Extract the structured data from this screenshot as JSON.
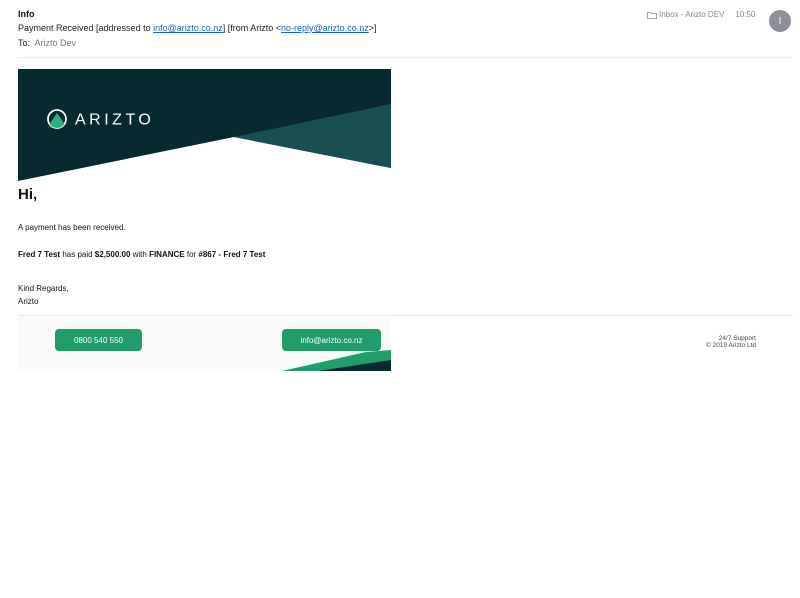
{
  "header": {
    "sender": "Info",
    "subject_prefix": "Payment Received [addressed to ",
    "addressed_email": "info@arizto.co.nz",
    "subject_middle": "] [from Arizto <",
    "from_email": "no-reply@arizto.co.nz",
    "subject_suffix": ">]",
    "to_label": "To:",
    "to_name": "Arizto Dev",
    "folder": "Inbox - Arizto DEV",
    "time": "10:50",
    "avatar_letter": "I"
  },
  "brand": {
    "logo_text": "ARIZTO"
  },
  "body": {
    "greeting": "Hi,",
    "line1": "A payment has been received.",
    "payer": "Fred 7 Test",
    "has_paid": " has paid ",
    "amount": "$2,500.00",
    "with": " with ",
    "method": "FINANCE",
    "for": " for ",
    "invoice": "#867 - Fred 7 Test",
    "signoff": "Kind Regards,",
    "signname": "Arizto"
  },
  "footer": {
    "phone": "0800 540 550",
    "email": "info@arizto.co.nz",
    "support_line1": "24/7 Support",
    "support_line2": "© 2019 Arizto Ltd"
  },
  "colors": {
    "banner_dark": "#062a30",
    "banner_teal": "#174f53",
    "brand_green": "#1f9e6b",
    "link_blue": "#1a5fd0"
  }
}
